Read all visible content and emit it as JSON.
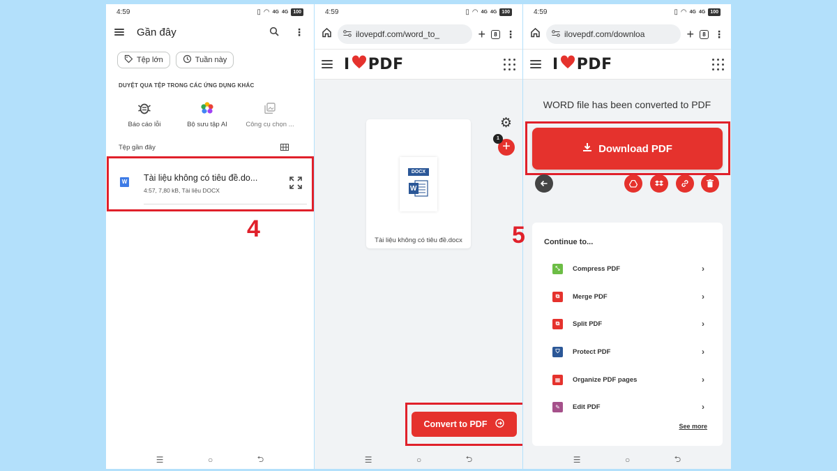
{
  "status": {
    "time": "4:59",
    "signal": "4G",
    "battery": "100"
  },
  "panel1": {
    "title": "Gần đây",
    "chips": [
      {
        "label": "Tệp lớn"
      },
      {
        "label": "Tuần này"
      }
    ],
    "section_caption": "DUYỆT QUA TỆP TRONG CÁC ỨNG DỤNG KHÁC",
    "apps": [
      {
        "label": "Báo cáo lỗi"
      },
      {
        "label": "Bộ sưu tập AI"
      },
      {
        "label": "Công cụ chọn ..."
      }
    ],
    "recent_label": "Tệp gần đây",
    "file": {
      "icon_letter": "W",
      "name": "Tài liệu không có tiêu đề.do...",
      "meta": "4:57, 7,80 kB, Tài liệu DOCX"
    },
    "step": "4"
  },
  "panel2": {
    "url": "ilovepdf.com/word_to_",
    "tab_count": "8",
    "logo_left": "I",
    "logo_right": "PDF",
    "doc_badge": "DOCX",
    "doc_letter": "W",
    "doc_name": "Tài liệu không có tiêu đề.docx",
    "file_count": "1",
    "convert_label": "Convert to PDF"
  },
  "panel3": {
    "url": "ilovepdf.com/downloa",
    "tab_count": "8",
    "logo_left": "I",
    "logo_right": "PDF",
    "converted_title": "WORD file has been converted to PDF",
    "download_label": "Download PDF",
    "step": "5",
    "continue_title": "Continue to...",
    "tools": [
      {
        "label": "Compress PDF",
        "icon": "compress-icon",
        "color": "#6cbd45"
      },
      {
        "label": "Merge PDF",
        "icon": "merge-icon",
        "color": "#e5322d"
      },
      {
        "label": "Split PDF",
        "icon": "split-icon",
        "color": "#e5322d"
      },
      {
        "label": "Protect PDF",
        "icon": "shield-icon",
        "color": "#2b5797"
      },
      {
        "label": "Organize PDF pages",
        "icon": "organize-icon",
        "color": "#e5322d"
      },
      {
        "label": "Edit PDF",
        "icon": "pencil-icon",
        "color": "#a5508a"
      }
    ],
    "see_more": "See more"
  },
  "colors": {
    "accent": "#e5322d",
    "highlight": "#e0202a",
    "background": "#b3e0fb"
  }
}
